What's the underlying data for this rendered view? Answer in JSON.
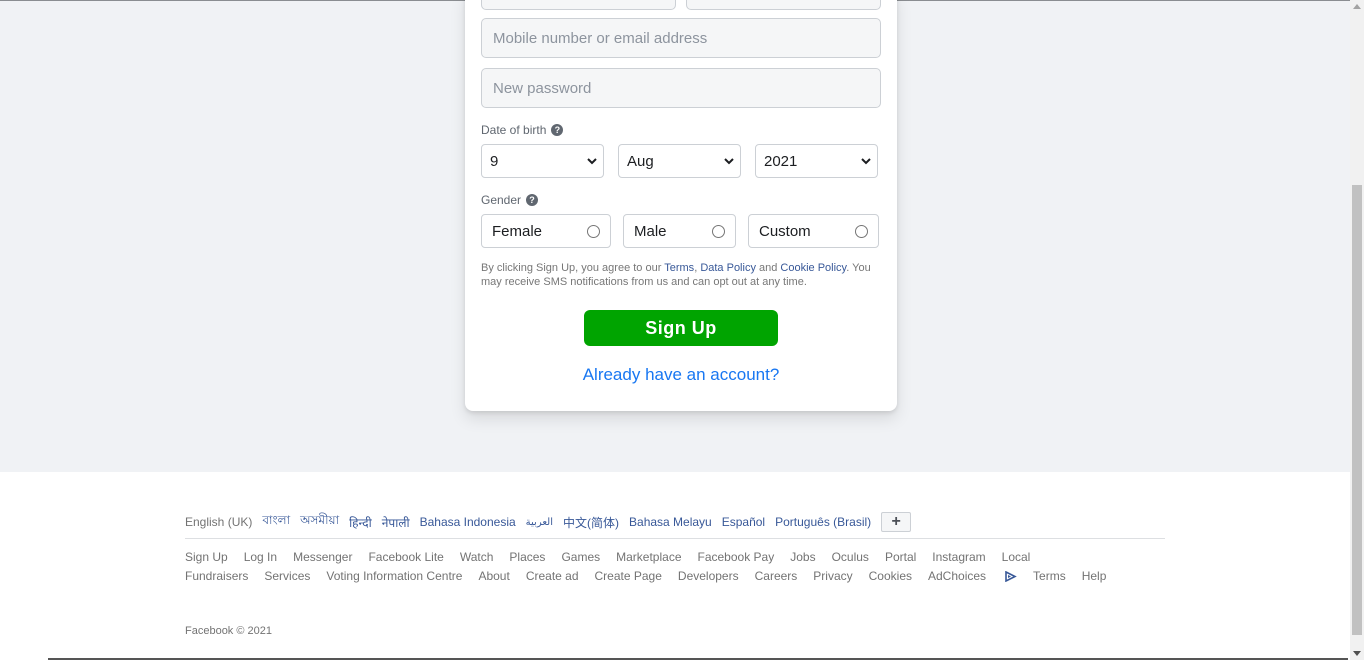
{
  "form": {
    "mobile_placeholder": "Mobile number or email address",
    "password_placeholder": "New password",
    "dob_label": "Date of birth",
    "dob_day": "9",
    "dob_month": "Aug",
    "dob_year": "2021",
    "gender_label": "Gender",
    "gender_female": "Female",
    "gender_male": "Male",
    "gender_custom": "Custom",
    "terms_prefix": "By clicking Sign Up, you agree to our ",
    "terms_link": "Terms",
    "terms_comma": ", ",
    "data_policy_link": "Data Policy",
    "terms_and": " and ",
    "cookie_policy_link": "Cookie Policy",
    "terms_suffix": ". You may receive SMS notifications from us and can opt out at any time.",
    "signup_button": "Sign Up",
    "already_link": "Already have an account?"
  },
  "footer": {
    "languages": [
      "English (UK)",
      "বাংলা",
      "অসমীয়া",
      "हिन्दी",
      "नेपाली",
      "Bahasa Indonesia",
      "العربية",
      "中文(简体)",
      "Bahasa Melayu",
      "Español",
      "Português (Brasil)"
    ],
    "more_languages": "+",
    "links": [
      "Sign Up",
      "Log In",
      "Messenger",
      "Facebook Lite",
      "Watch",
      "Places",
      "Games",
      "Marketplace",
      "Facebook Pay",
      "Jobs",
      "Oculus",
      "Portal",
      "Instagram",
      "Local",
      "Fundraisers",
      "Services",
      "Voting Information Centre",
      "About",
      "Create ad",
      "Create Page",
      "Developers",
      "Careers",
      "Privacy",
      "Cookies",
      "AdChoices",
      "Terms",
      "Help"
    ],
    "copyright": "Facebook © 2021"
  },
  "colors": {
    "signup_green": "#00a400",
    "link_blue": "#1877f2",
    "footer_link": "#385898"
  }
}
